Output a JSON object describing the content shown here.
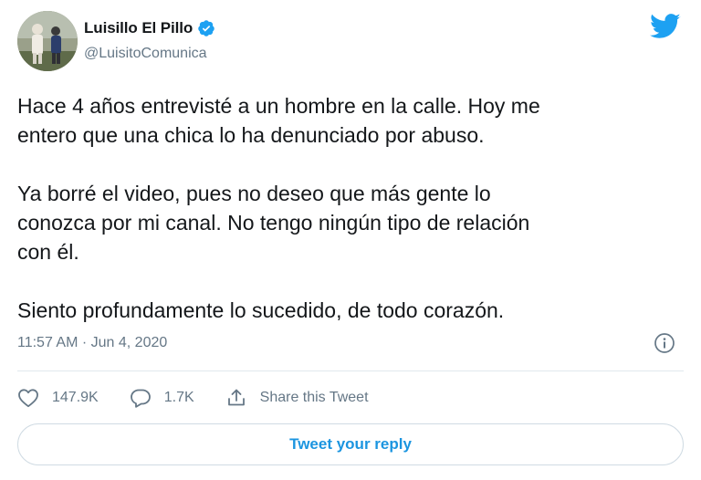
{
  "author": {
    "display_name": "Luisillo El Pillo",
    "handle": "@LuisitoComunica",
    "verified": true
  },
  "tweet": {
    "paragraphs": [
      "Hace 4 años entrevisté a un hombre en la calle. Hoy me\nentero que una chica lo ha denunciado por abuso.",
      "Ya borré el video, pues no deseo que más gente lo\nconozca por mi canal. No tengo ningún tipo de relación\ncon él.",
      "Siento profundamente lo sucedido, de todo corazón."
    ],
    "timestamp": "11:57 AM · Jun 4, 2020"
  },
  "actions": {
    "likes": "147.9K",
    "replies": "1.7K",
    "share_label": "Share this Tweet"
  },
  "reply_button_label": "Tweet your reply",
  "icons": {
    "brand": "twitter-bird-icon",
    "verified": "verified-badge-icon",
    "info": "info-icon",
    "like": "heart-icon",
    "reply": "speech-bubble-icon",
    "share": "share-icon"
  },
  "colors": {
    "brand_blue": "#1da1f2",
    "link_blue": "#1b95e0",
    "secondary_text": "#657786",
    "primary_text": "#14171a"
  }
}
